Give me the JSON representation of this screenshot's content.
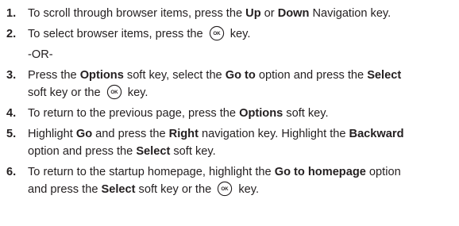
{
  "steps": [
    {
      "number": "1.",
      "lines": [
        {
          "parts": [
            {
              "text": "To scroll through browser items, press the "
            },
            {
              "text": "Up",
              "bold": true
            },
            {
              "text": " or "
            },
            {
              "text": "Down",
              "bold": true
            },
            {
              "text": " Navigation key."
            }
          ]
        }
      ]
    },
    {
      "number": "2.",
      "lines": [
        {
          "parts": [
            {
              "text": "To select browser items, press the "
            },
            {
              "key": "OK"
            },
            {
              "text": " key."
            }
          ]
        }
      ],
      "alternative": "-OR-"
    },
    {
      "number": "3.",
      "lines": [
        {
          "parts": [
            {
              "text": "Press the "
            },
            {
              "text": "Options",
              "bold": true
            },
            {
              "text": " soft key, select the "
            },
            {
              "text": "Go to",
              "bold": true
            },
            {
              "text": " option and press the "
            },
            {
              "text": "Select",
              "bold": true
            }
          ]
        },
        {
          "parts": [
            {
              "text": "soft key or the "
            },
            {
              "key": "OK"
            },
            {
              "text": " key."
            }
          ]
        }
      ]
    },
    {
      "number": "4.",
      "lines": [
        {
          "parts": [
            {
              "text": "To return to the previous page, press the "
            },
            {
              "text": "Options",
              "bold": true
            },
            {
              "text": " soft key."
            }
          ]
        }
      ]
    },
    {
      "number": "5.",
      "lines": [
        {
          "parts": [
            {
              "text": "Highlight "
            },
            {
              "text": "Go",
              "bold": true
            },
            {
              "text": " and press the "
            },
            {
              "text": "Right",
              "bold": true
            },
            {
              "text": " navigation key. Highlight the "
            },
            {
              "text": "Backward",
              "bold": true
            }
          ]
        },
        {
          "parts": [
            {
              "text": "option and press the "
            },
            {
              "text": "Select",
              "bold": true
            },
            {
              "text": " soft key."
            }
          ]
        }
      ]
    },
    {
      "number": "6.",
      "lines": [
        {
          "parts": [
            {
              "text": "To return to the startup homepage, highlight the "
            },
            {
              "text": "Go to homepage",
              "bold": true
            },
            {
              "text": " option"
            }
          ]
        },
        {
          "parts": [
            {
              "text": "and press the "
            },
            {
              "text": "Select",
              "bold": true
            },
            {
              "text": " soft key or the "
            },
            {
              "key": "OK"
            },
            {
              "text": " key."
            }
          ]
        }
      ]
    }
  ],
  "colors": {
    "text": "#231f20",
    "background": "#ffffff"
  }
}
